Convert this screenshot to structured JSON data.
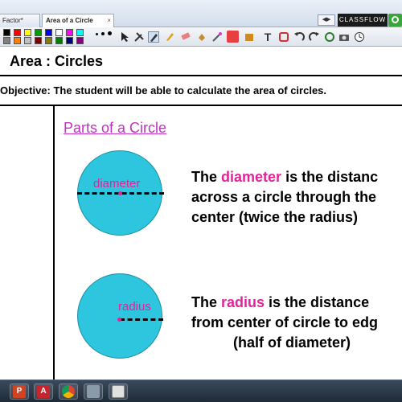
{
  "tabs": [
    {
      "label": "Factor*",
      "active": false
    },
    {
      "label": "Area of a Circle",
      "active": true
    }
  ],
  "tab_close_glyph": "×",
  "tab_scroll_glyph": "◀▶",
  "classflow_label": "CLASSFLOW",
  "toolbar": {
    "colors": [
      "#000000",
      "#ff0000",
      "#ffff00",
      "#00a000",
      "#0000ff",
      "#ffffff",
      "#ff00ff",
      "#00ffff",
      "#808080",
      "#ff8000",
      "#c0c0c0",
      "#800000",
      "#808000",
      "#008000",
      "#000080",
      "#800080"
    ],
    "icons": [
      "select-arrow-icon",
      "tools-icon",
      "pen-icon",
      "highlighter-icon",
      "eraser-icon",
      "fill-icon",
      "magic-pen-icon",
      "shape-icon",
      "connector-icon",
      "text-icon",
      "reset-icon",
      "undo-icon",
      "redo-icon",
      "refresh-icon",
      "camera-icon",
      "clock-icon"
    ],
    "text_tool": "T"
  },
  "page": {
    "title": "Area : Circles",
    "objective": "Objective: The student will be able to calculate the area of circles.",
    "section_title": "Parts of a Circle",
    "circle1_label": "diameter",
    "circle2_label": "radius",
    "block1": {
      "line1_pre": "The ",
      "line1_hl": "diameter",
      "line1_post": " is the distanc",
      "line2": "across a circle through the",
      "line3": "center    (twice the radius)"
    },
    "block2": {
      "line1_pre": "The ",
      "line1_hl": "radius",
      "line1_post": " is the distance",
      "line2": "from center of circle to edg",
      "line3": "(half of diameter)"
    },
    "accent_color": "#e0249a",
    "title_color": "#c530c8",
    "circle_color": "#2ec5de"
  },
  "taskbar": {
    "items": [
      "powerpoint-icon",
      "activinspire-icon",
      "chrome-icon",
      "explorer-icon",
      "activinspire-window-icon"
    ],
    "labels": [
      "P",
      "A"
    ]
  }
}
